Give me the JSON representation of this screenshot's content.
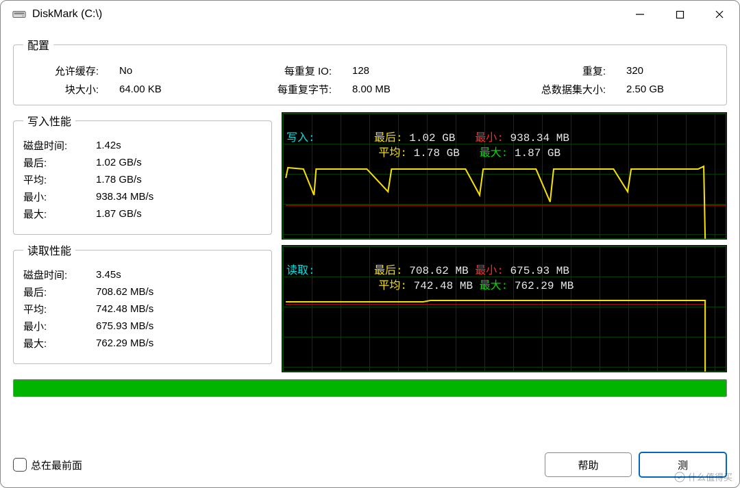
{
  "window": {
    "title": "DiskMark (C:\\)"
  },
  "config": {
    "legend": "配置",
    "cache_label": "允许缓存:",
    "cache_value": "No",
    "io_label": "每重复 IO:",
    "io_value": "128",
    "repeat_label": "重复:",
    "repeat_value": "320",
    "block_label": "块大小:",
    "block_value": "64.00 KB",
    "bytes_label": "每重复字节:",
    "bytes_value": "8.00 MB",
    "dataset_label": "总数据集大小:",
    "dataset_value": "2.50 GB"
  },
  "write": {
    "legend": "写入性能",
    "rows": [
      {
        "l": "磁盘时间:",
        "v": "1.42s"
      },
      {
        "l": "最后:",
        "v": "1.02 GB/s"
      },
      {
        "l": "平均:",
        "v": "1.78 GB/s"
      },
      {
        "l": "最小:",
        "v": "938.34 MB/s"
      },
      {
        "l": "最大:",
        "v": "1.87 GB/s"
      }
    ],
    "graph": {
      "name": "写入:",
      "last_l": "最后:",
      "last_v": "1.02 GB",
      "avg_l": "平均:",
      "avg_v": "1.78 GB",
      "min_l": "最小:",
      "min_v": "938.34 MB",
      "max_l": "最大:",
      "max_v": "1.87 GB"
    }
  },
  "read": {
    "legend": "读取性能",
    "rows": [
      {
        "l": "磁盘时间:",
        "v": "3.45s"
      },
      {
        "l": "最后:",
        "v": "708.62 MB/s"
      },
      {
        "l": "平均:",
        "v": "742.48 MB/s"
      },
      {
        "l": "最小:",
        "v": "675.93 MB/s"
      },
      {
        "l": "最大:",
        "v": "762.29 MB/s"
      }
    ],
    "graph": {
      "name": "读取:",
      "last_l": "最后:",
      "last_v": "708.62 MB",
      "avg_l": "平均:",
      "avg_v": "742.48 MB",
      "min_l": "最小:",
      "min_v": "675.93 MB",
      "max_l": "最大:",
      "max_v": "762.29 MB"
    }
  },
  "footer": {
    "always_on_top": "总在最前面",
    "help": "帮助",
    "test": "测"
  },
  "watermark": "什么值得买",
  "chart_data": [
    {
      "type": "line",
      "title": "写入",
      "series": [
        {
          "name": "speed",
          "values_gb_s": [
            1.85,
            1.8,
            1.8,
            1.7,
            1.8,
            1.78,
            1.6,
            1.8,
            1.78,
            1.55,
            1.8,
            1.75,
            1.8,
            1.6,
            1.8,
            1.02
          ]
        }
      ],
      "stats": {
        "last": 1.02,
        "avg": 1.78,
        "min": 0.93834,
        "max": 1.87,
        "unit": "GB/s"
      },
      "ylim": [
        0,
        2.0
      ]
    },
    {
      "type": "line",
      "title": "读取",
      "series": [
        {
          "name": "speed",
          "values_mb_s": [
            740,
            738,
            742,
            745,
            740,
            742,
            745,
            742,
            740,
            742,
            745,
            742,
            740,
            742,
            745,
            708.62
          ]
        }
      ],
      "stats": {
        "last": 708.62,
        "avg": 742.48,
        "min": 675.93,
        "max": 762.29,
        "unit": "MB/s"
      },
      "ylim": [
        0,
        800
      ]
    }
  ]
}
